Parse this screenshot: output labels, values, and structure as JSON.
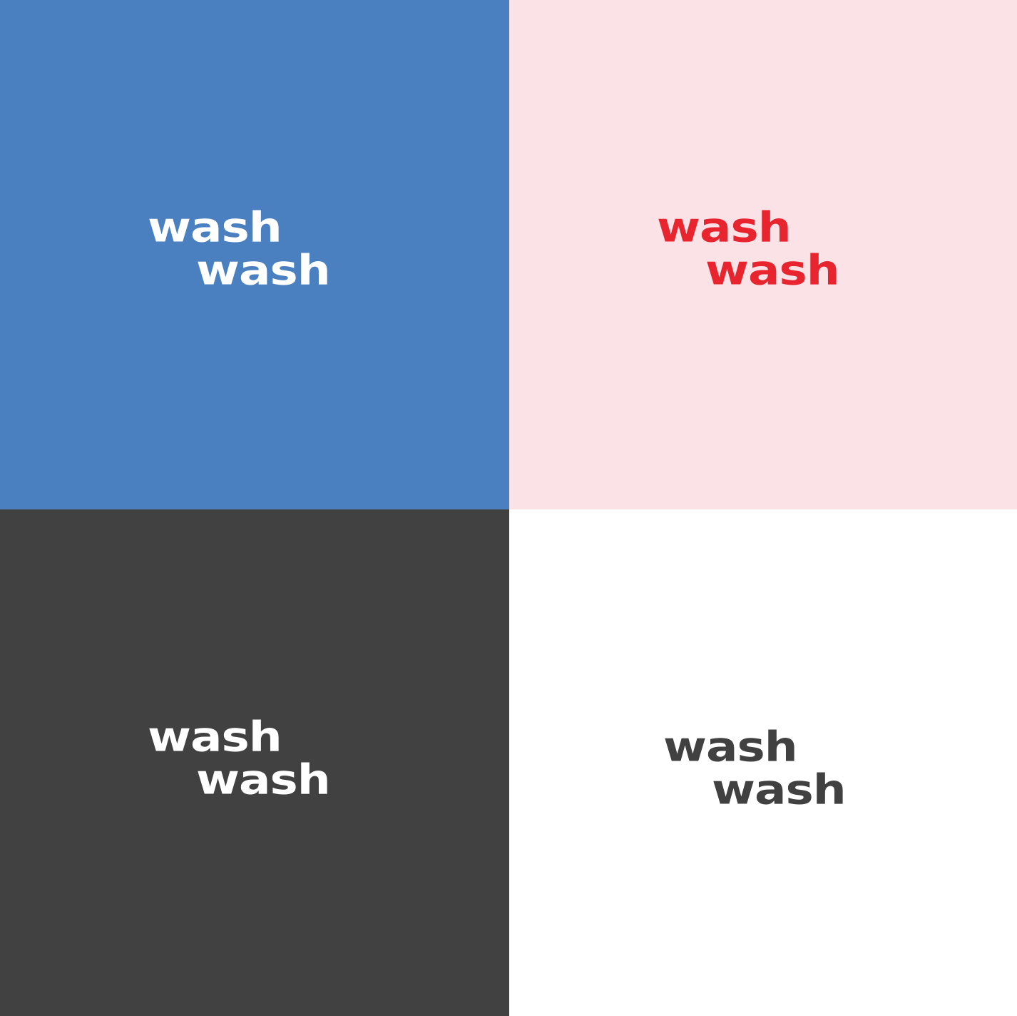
{
  "panels": [
    {
      "background": "#4a80c0",
      "text_color": "#ffffff",
      "line1": "wash",
      "line2": "wash"
    },
    {
      "background": "#fbe2e6",
      "text_color": "#e8242e",
      "line1": "wash",
      "line2": "wash"
    },
    {
      "background": "#414141",
      "text_color": "#ffffff",
      "line1": "wash",
      "line2": "wash"
    },
    {
      "background": "#ffffff",
      "text_color": "#414141",
      "line1": "wash",
      "line2": "wash"
    }
  ]
}
